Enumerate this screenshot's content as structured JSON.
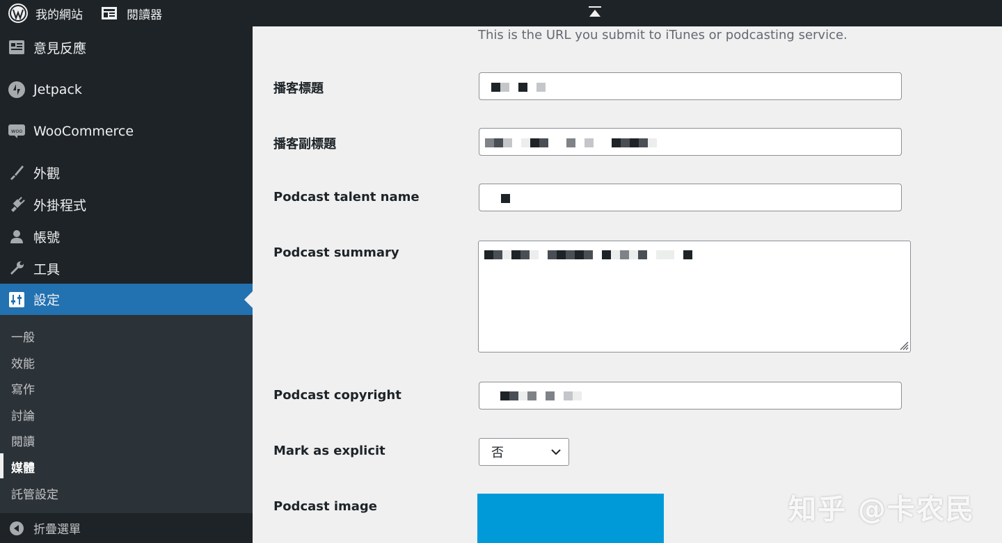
{
  "adminbar": {
    "site_name": "我的網站",
    "reader_label": "閱讀器",
    "icons": {
      "site": "wordpress-icon",
      "reader": "reader-icon",
      "collapse": "collapse-up-icon"
    }
  },
  "sidebar": {
    "items": [
      {
        "label": "意見反應",
        "icon": "feedback-icon"
      },
      {
        "label": "Jetpack",
        "icon": "jetpack-icon"
      },
      {
        "label": "WooCommerce",
        "icon": "woocommerce-icon"
      },
      {
        "label": "外觀",
        "icon": "appearance-brush-icon"
      },
      {
        "label": "外掛程式",
        "icon": "plugins-icon"
      },
      {
        "label": "帳號",
        "icon": "user-icon"
      },
      {
        "label": "工具",
        "icon": "wrench-icon"
      },
      {
        "label": "設定",
        "icon": "settings-icon",
        "current": true
      }
    ],
    "submenu": [
      {
        "label": "一般"
      },
      {
        "label": "效能"
      },
      {
        "label": "寫作"
      },
      {
        "label": "討論"
      },
      {
        "label": "閱讀"
      },
      {
        "label": "媒體",
        "current": true
      },
      {
        "label": "託管設定"
      }
    ],
    "collapse_label": "折疊選單"
  },
  "form": {
    "description": "This is the URL you submit to iTunes or podcasting service.",
    "fields": [
      {
        "label": "播客標題",
        "value_visible_prefix": ""
      },
      {
        "label": "播客副標題",
        "value_visible_prefix": "濾股… "
      },
      {
        "label": "Podcast talent name",
        "value_visible_prefix": ""
      },
      {
        "label": "Podcast summary",
        "value_visible_prefix": "濾股… "
      },
      {
        "label": "Podcast copyright",
        "value_visible_prefix": ""
      },
      {
        "label": "Mark as explicit",
        "value": "否"
      },
      {
        "label": "Podcast image"
      }
    ]
  },
  "watermark": "知乎 @卡农民",
  "colors": {
    "sidebar_bg": "#1d2327",
    "submenu_bg": "#2c3338",
    "accent": "#2271b1",
    "image_preview": "#009ad9",
    "content_bg": "#f0f0f1"
  }
}
